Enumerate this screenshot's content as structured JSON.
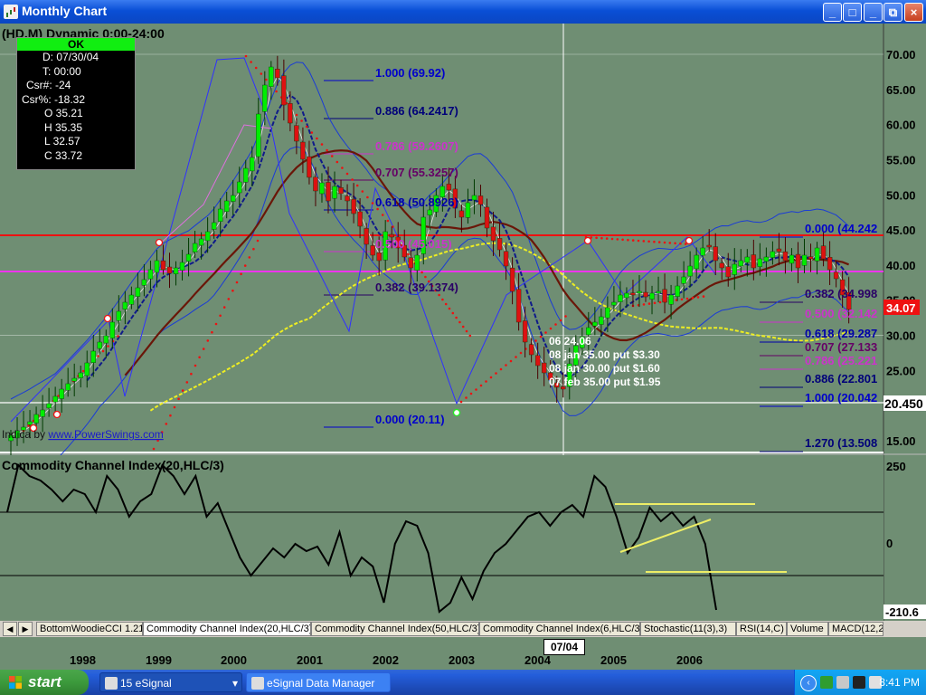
{
  "window": {
    "title": "Monthly Chart",
    "buttons": [
      "_",
      "□",
      "×"
    ]
  },
  "header": {
    "symbol_line": "(HD,M) Dynamic 0:00-24:00"
  },
  "infobox": {
    "status": "OK",
    "rows": [
      "D: 07/30/04",
      "T: 00:00",
      "Csr#: -24",
      "Csr%: -18.32",
      "O 35.21",
      "H 35.35",
      "L 32.57",
      "C 33.72"
    ]
  },
  "price_axis": {
    "ticks": [
      "70.00",
      "65.00",
      "60.00",
      "55.00",
      "50.00",
      "45.00",
      "40.00",
      "35.00",
      "30.00",
      "25.00",
      "20.00",
      "15.00"
    ],
    "last_price": "34.07",
    "cursor_price": "20.450"
  },
  "fib_left": [
    {
      "ratio": "1.000",
      "value": "(69.92)",
      "color": "#0000cc"
    },
    {
      "ratio": "0.886",
      "value": "(64.2417)",
      "color": "#00007a"
    },
    {
      "ratio": "0.786",
      "value": "(59.2607)",
      "color": "#cc33cc"
    },
    {
      "ratio": "0.707",
      "value": "(55.3257)",
      "color": "#660066"
    },
    {
      "ratio": "0.618",
      "value": "(50.8926)",
      "color": "#0000aa"
    },
    {
      "ratio": "0.500",
      "value": "(45.015)",
      "color": "#cc33cc"
    },
    {
      "ratio": "0.382",
      "value": "(39.1374)",
      "color": "#2a0066"
    },
    {
      "ratio": "0.000",
      "value": "(20.11)",
      "color": "#0000cc"
    }
  ],
  "fib_right": [
    {
      "ratio": "0.000",
      "value": "(44.242",
      "color": "#0000cc"
    },
    {
      "ratio": "0.382",
      "value": "(34.998",
      "color": "#2a0066"
    },
    {
      "ratio": "0.500",
      "value": "(32.142",
      "color": "#cc33cc"
    },
    {
      "ratio": "0.618",
      "value": "(29.287",
      "color": "#0000aa"
    },
    {
      "ratio": "0.707",
      "value": "(27.133",
      "color": "#660066"
    },
    {
      "ratio": "0.786",
      "value": "(25.221",
      "color": "#cc33cc"
    },
    {
      "ratio": "0.886",
      "value": "(22.801",
      "color": "#00007a"
    },
    {
      "ratio": "1.000",
      "value": "(20.042",
      "color": "#0000cc"
    },
    {
      "ratio": "1.270",
      "value": "(13.508",
      "color": "#00007a"
    }
  ],
  "notes": [
    "06 24.06",
    "08 jan 35.00 put $3.30",
    "08 jan 30.00 put $1.60",
    "07 feb 35.00 put $1.95"
  ],
  "credit": {
    "prefix": "Indica",
    "mid": " by ",
    "link": "www.PowerSwings.com"
  },
  "indicator": {
    "title": "Commodity Channel Index(20,HLC/3)",
    "ticks": [
      "250",
      "0"
    ],
    "last_value": "-210.6"
  },
  "tabs": [
    "BottomWoodieCCI 1.21",
    "Commodity Channel Index(20,HLC/3)",
    "Commodity Channel Index(50,HLC/3)",
    "Commodity Channel Index(6,HLC/3)",
    "Stochastic(11(3),3)",
    "RSI(14,C)",
    "Volume",
    "MACD(12,2"
  ],
  "time_axis": {
    "years": [
      "1998",
      "1999",
      "2000",
      "2001",
      "2002",
      "2003",
      "2004",
      "2005",
      "2006"
    ],
    "cursor_date": "07/04"
  },
  "taskbar": {
    "start": "start",
    "tasks": [
      "15 eSignal",
      "eSignal Data Manager"
    ],
    "clock": "8:41 PM"
  },
  "colors": {
    "up_candle": "#00ee00",
    "down_candle": "#dd1111",
    "resistance": "#ee1111",
    "pivot": "#ee33ee",
    "ma_slow": "#7a1a10",
    "ma_long": "#eeee22"
  }
}
